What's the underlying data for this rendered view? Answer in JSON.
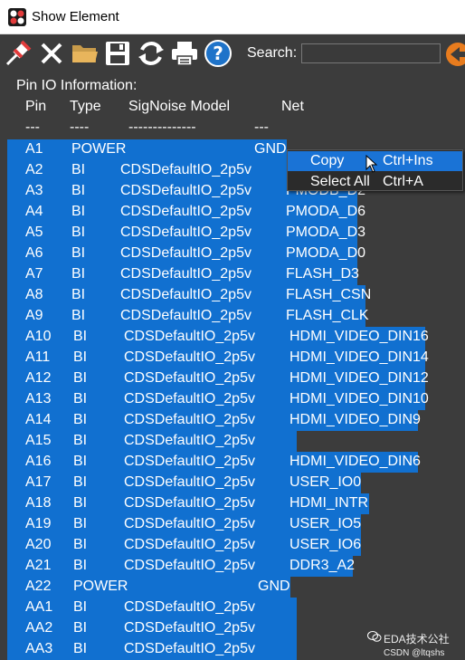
{
  "window": {
    "title": "Show Element"
  },
  "toolbar": {
    "buttons": [
      {
        "icon": "pin-icon"
      },
      {
        "icon": "close-x-icon"
      },
      {
        "icon": "folder-open-icon"
      },
      {
        "icon": "save-icon"
      },
      {
        "icon": "refresh-icon"
      },
      {
        "icon": "print-icon"
      },
      {
        "icon": "help-icon"
      }
    ],
    "search_label": "Search:",
    "search_value": "",
    "go_icon": "arrow-go-icon"
  },
  "content": {
    "section_title": "Pin IO Information:",
    "columns": [
      "Pin",
      "Type",
      "SigNoise Model",
      "Net"
    ],
    "dashes": [
      "---",
      "----",
      "--------------",
      "---"
    ],
    "rows": [
      {
        "pin": "A1",
        "type": "POWER",
        "model": "",
        "net": "GND"
      },
      {
        "pin": "A2",
        "type": "BI",
        "model": "CDSDefaultIO_2p5v",
        "net": ""
      },
      {
        "pin": "A3",
        "type": "BI",
        "model": "CDSDefaultIO_2p5v",
        "net": "PMODB_D2"
      },
      {
        "pin": "A4",
        "type": "BI",
        "model": "CDSDefaultIO_2p5v",
        "net": "PMODA_D6"
      },
      {
        "pin": "A5",
        "type": "BI",
        "model": "CDSDefaultIO_2p5v",
        "net": "PMODA_D3"
      },
      {
        "pin": "A6",
        "type": "BI",
        "model": "CDSDefaultIO_2p5v",
        "net": "PMODA_D0"
      },
      {
        "pin": "A7",
        "type": "BI",
        "model": "CDSDefaultIO_2p5v",
        "net": "FLASH_D3"
      },
      {
        "pin": "A8",
        "type": "BI",
        "model": "CDSDefaultIO_2p5v",
        "net": "FLASH_CSN"
      },
      {
        "pin": "A9",
        "type": "BI",
        "model": "CDSDefaultIO_2p5v",
        "net": "FLASH_CLK"
      },
      {
        "pin": "A10",
        "type": "BI",
        "model": "CDSDefaultIO_2p5v",
        "net": "HDMI_VIDEO_DIN16"
      },
      {
        "pin": "A11",
        "type": "BI",
        "model": "CDSDefaultIO_2p5v",
        "net": "HDMI_VIDEO_DIN14"
      },
      {
        "pin": "A12",
        "type": "BI",
        "model": "CDSDefaultIO_2p5v",
        "net": "HDMI_VIDEO_DIN12"
      },
      {
        "pin": "A13",
        "type": "BI",
        "model": "CDSDefaultIO_2p5v",
        "net": "HDMI_VIDEO_DIN10"
      },
      {
        "pin": "A14",
        "type": "BI",
        "model": "CDSDefaultIO_2p5v",
        "net": "HDMI_VIDEO_DIN9"
      },
      {
        "pin": "A15",
        "type": "BI",
        "model": "CDSDefaultIO_2p5v",
        "net": ""
      },
      {
        "pin": "A16",
        "type": "BI",
        "model": "CDSDefaultIO_2p5v",
        "net": "HDMI_VIDEO_DIN6"
      },
      {
        "pin": "A17",
        "type": "BI",
        "model": "CDSDefaultIO_2p5v",
        "net": "USER_IO0"
      },
      {
        "pin": "A18",
        "type": "BI",
        "model": "CDSDefaultIO_2p5v",
        "net": "HDMI_INTR"
      },
      {
        "pin": "A19",
        "type": "BI",
        "model": "CDSDefaultIO_2p5v",
        "net": "USER_IO5"
      },
      {
        "pin": "A20",
        "type": "BI",
        "model": "CDSDefaultIO_2p5v",
        "net": "USER_IO6"
      },
      {
        "pin": "A21",
        "type": "BI",
        "model": "CDSDefaultIO_2p5v",
        "net": "DDR3_A2"
      },
      {
        "pin": "A22",
        "type": "POWER",
        "model": "",
        "net": "GND"
      },
      {
        "pin": "AA1",
        "type": "BI",
        "model": "CDSDefaultIO_2p5v",
        "net": ""
      },
      {
        "pin": "AA2",
        "type": "BI",
        "model": "CDSDefaultIO_2p5v",
        "net": ""
      },
      {
        "pin": "AA3",
        "type": "BI",
        "model": "CDSDefaultIO_2p5v",
        "net": ""
      }
    ]
  },
  "context_menu": {
    "items": [
      {
        "label": "Copy",
        "shortcut": "Ctrl+Ins",
        "active": true
      },
      {
        "label": "Select All",
        "shortcut": "Ctrl+A",
        "active": false
      }
    ]
  },
  "watermark": {
    "brand": "EDA技术公社",
    "credit": "CSDN @ltqshs"
  },
  "colors": {
    "selection": "#1170d0",
    "background": "#3c3c3c",
    "menu_highlight": "#1a73d6"
  }
}
